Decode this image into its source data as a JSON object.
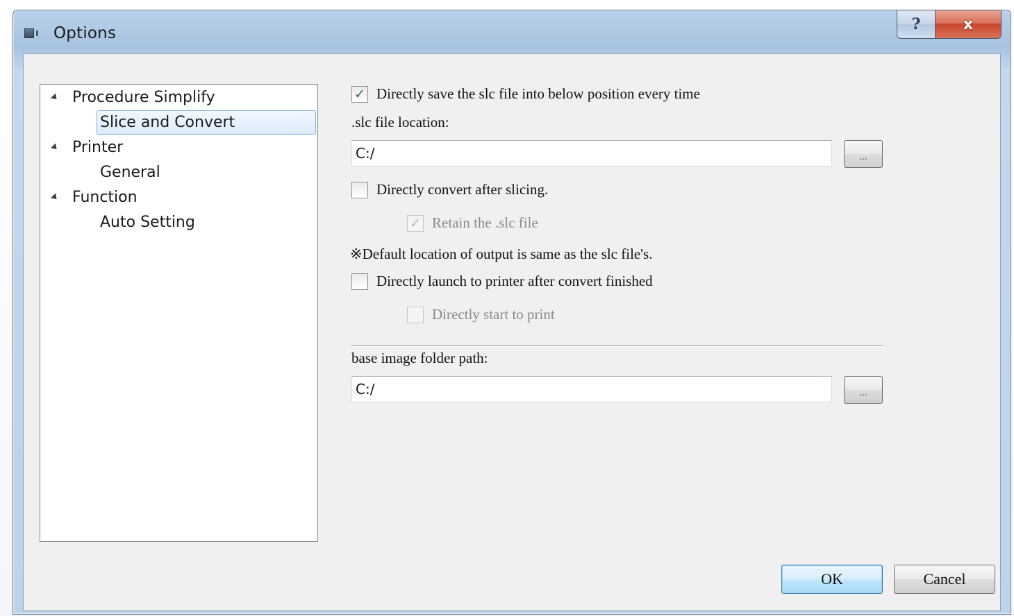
{
  "window": {
    "title": "Options",
    "help_glyph": "?",
    "close_glyph": "x"
  },
  "tree": {
    "items": [
      {
        "label": "Procedure Simplify",
        "expanded": true,
        "level": 0
      },
      {
        "label": "Slice and Convert",
        "selected": true,
        "level": 1
      },
      {
        "label": "Printer",
        "expanded": true,
        "level": 0
      },
      {
        "label": "General",
        "level": 1
      },
      {
        "label": "Function",
        "expanded": true,
        "level": 0
      },
      {
        "label": "Auto Setting",
        "level": 1
      }
    ]
  },
  "options": {
    "save_slc": {
      "label": "Directly save the slc file into below position every time",
      "checked": true
    },
    "slc_location_label": ".slc file location:",
    "slc_location_value": "C:/",
    "browse_label": "...",
    "convert_after": {
      "label": "Directly convert after slicing.",
      "checked": false
    },
    "retain_slc": {
      "label": "Retain the .slc file",
      "checked": true,
      "disabled": true
    },
    "note": "※Default location of output is same as the slc file's.",
    "launch_printer": {
      "label": "Directly launch to printer after convert finished",
      "checked": false
    },
    "start_print": {
      "label": "Directly start to print",
      "checked": false,
      "disabled": true
    },
    "base_image_label": "base image folder path:",
    "base_image_value": "C:/"
  },
  "buttons": {
    "ok": "OK",
    "cancel": "Cancel"
  },
  "colors": {
    "selection_border": "#84acdd",
    "close_button": "#c8472c",
    "default_button_border": "#3c7fb1"
  }
}
